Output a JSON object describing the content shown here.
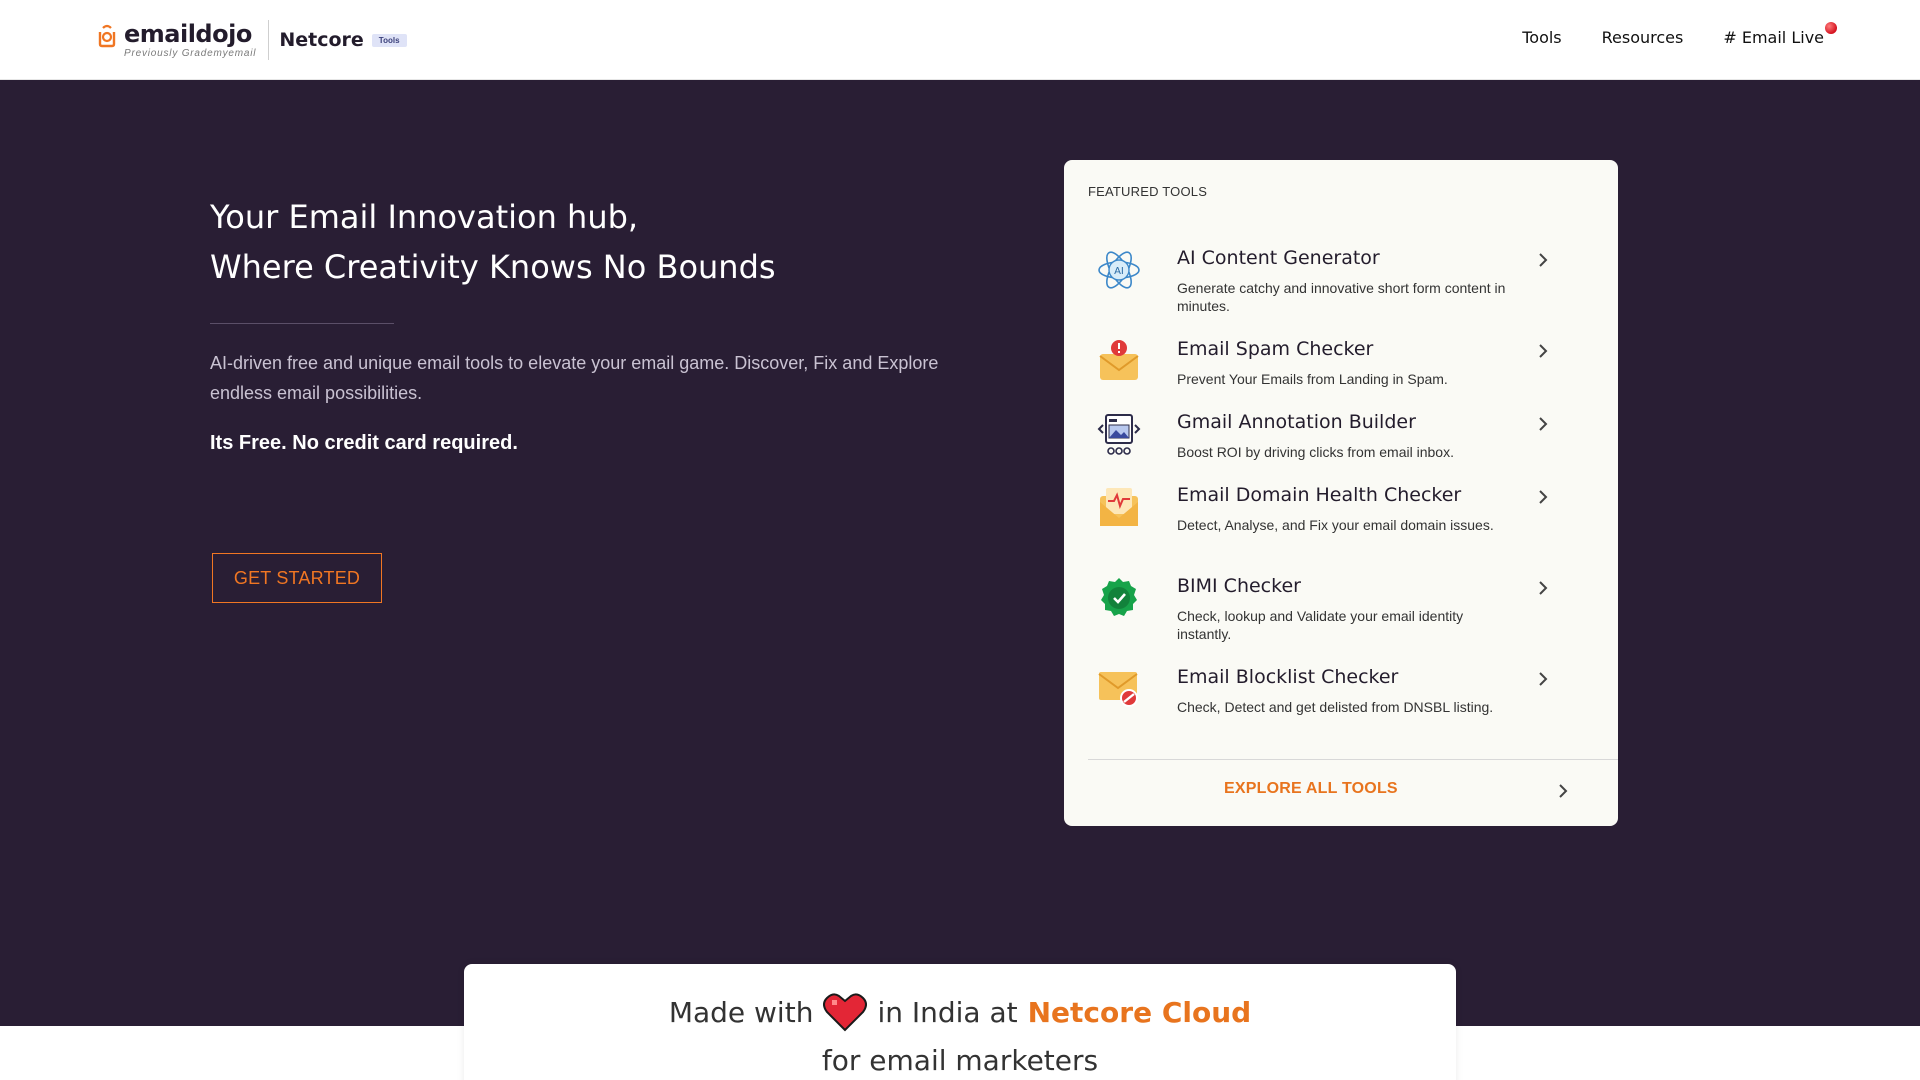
{
  "header": {
    "logo_text": "emaildojo",
    "logo_subtext": "Previously Grademyemail",
    "partner_name": "Netcore",
    "partner_badge": "Tools",
    "nav": [
      {
        "label": "Tools"
      },
      {
        "label": "Resources"
      },
      {
        "label": "# Email Live"
      }
    ]
  },
  "hero": {
    "title_line1": "Your Email Innovation hub,",
    "title_line2": "Where Creativity Knows No Bounds",
    "description": "AI-driven free and unique email tools to elevate your email game. Discover, Fix and Explore endless email possibilities.",
    "free_note": "Its Free. No credit card required.",
    "cta_label": "GET STARTED"
  },
  "featured": {
    "label": "FEATURED TOOLS",
    "tools": [
      {
        "title": "AI Content Generator",
        "desc": "Generate catchy and innovative short form content in minutes.",
        "icon": "ai-atom-icon"
      },
      {
        "title": "Email Spam Checker",
        "desc": "Prevent Your Emails from Landing in Spam.",
        "icon": "spam-envelope-icon"
      },
      {
        "title": "Gmail Annotation Builder",
        "desc": "Boost ROI by driving clicks from email inbox.",
        "icon": "annotation-builder-icon"
      },
      {
        "title": "Email Domain Health Checker",
        "desc": "Detect, Analyse, and Fix your email domain issues.",
        "icon": "domain-health-icon"
      },
      {
        "title": "BIMI Checker",
        "desc": "Check, lookup and Validate your email identity instantly.",
        "icon": "verified-badge-icon"
      },
      {
        "title": "Email Blocklist Checker",
        "desc": "Check, Detect and get delisted from DNSBL listing.",
        "icon": "blocklist-envelope-icon"
      }
    ],
    "explore_label": "EXPLORE ALL TOOLS"
  },
  "footer_note": {
    "made_with": "Made with",
    "in_india_at": "in India at",
    "company": "Netcore Cloud",
    "line2": "for email marketers"
  },
  "colors": {
    "hero_bg": "#291e34",
    "accent_orange": "#f07623",
    "card_bg": "#fafaf5"
  }
}
